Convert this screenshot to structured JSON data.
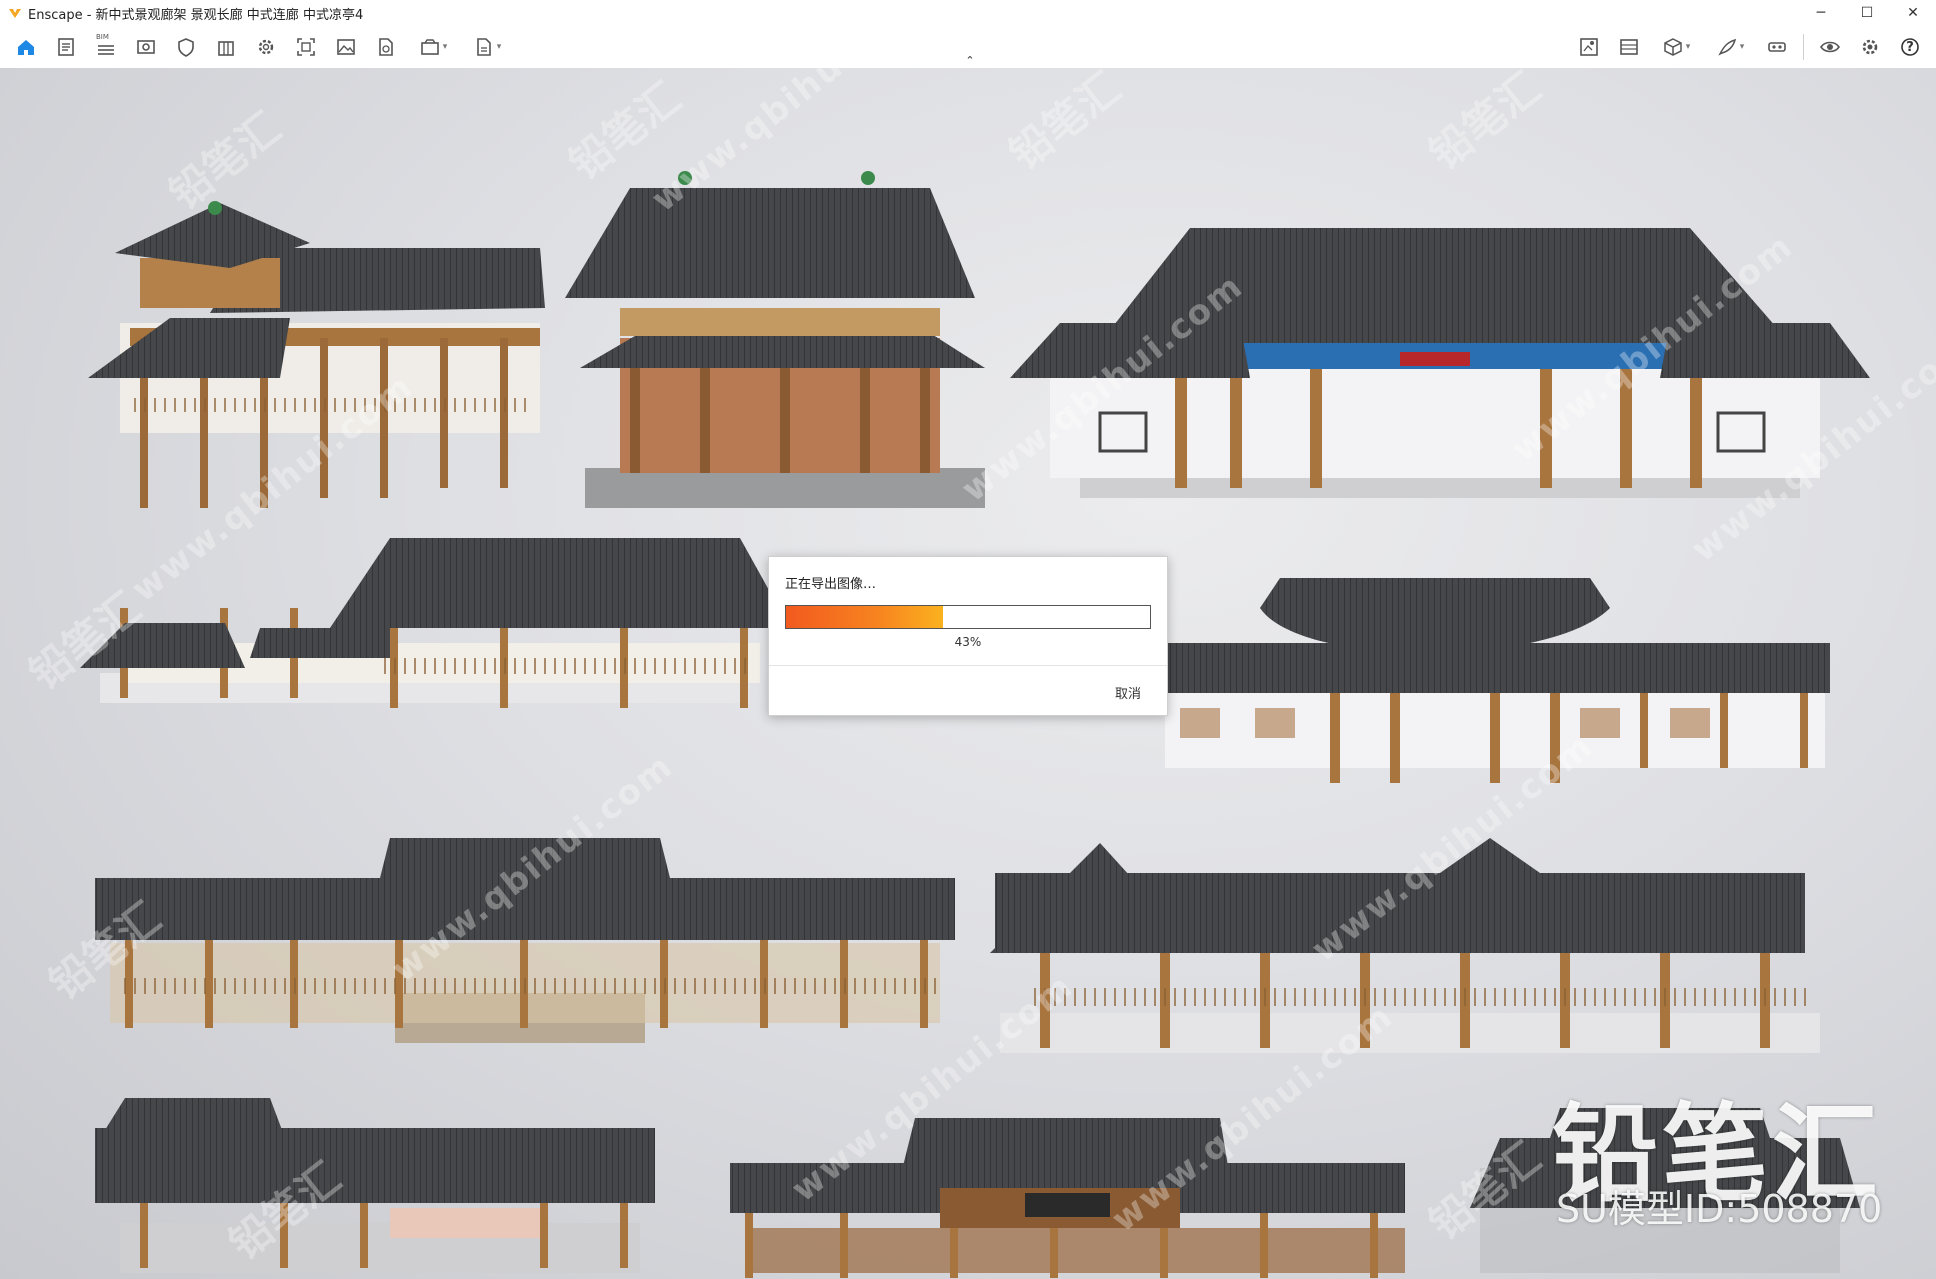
{
  "window": {
    "title": "Enscape - 新中式景观廊架 景观长廊 中式连廊 中式凉亭4",
    "minimize": "─",
    "maximize": "☐",
    "close": "✕"
  },
  "toolbar": {
    "bim_tag": "BIM",
    "left_icons": [
      "home-icon",
      "document-icon",
      "layers-icon",
      "view-icon",
      "shield-icon",
      "building-icon",
      "settings-cog-icon",
      "screenshot-icon",
      "image-icon",
      "file-export-icon",
      "batch-render-icon",
      "exe-export-icon"
    ],
    "right_icons": [
      "asset-library-icon",
      "material-icon",
      "cube-icon",
      "feather-icon",
      "vr-headset-icon",
      "eye-icon",
      "settings-icon",
      "help-icon"
    ],
    "help_label": "?",
    "collapse": "⌃"
  },
  "viewport": {
    "brand": "铅笔汇",
    "model_id": "SU模型ID:508870",
    "watermark_text": "铅笔汇",
    "watermark_url": "www.qbihui.com"
  },
  "dialog": {
    "title": "正在导出图像…",
    "progress_percent": 43,
    "progress_label": "43%",
    "cancel": "取消"
  },
  "colors": {
    "accent": "#1e88e5",
    "progress_start": "#f25a1f",
    "progress_end": "#fbb21f",
    "roof": "#3f4144",
    "timber": "#a8753f"
  }
}
